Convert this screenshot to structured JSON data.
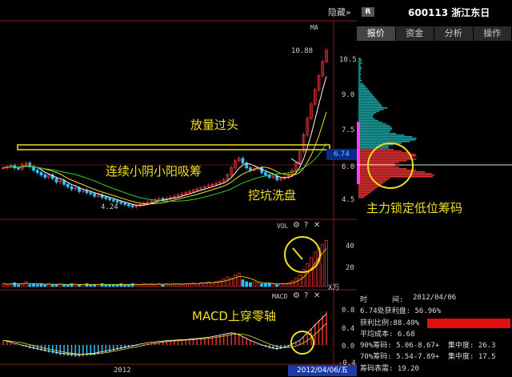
{
  "header": {
    "badge": "R",
    "code": "600113 浙江东日",
    "hide": "隐藏»"
  },
  "tabs": [
    {
      "label": "报价",
      "active": true
    },
    {
      "label": "资金",
      "active": false
    },
    {
      "label": "分析",
      "active": false
    },
    {
      "label": "操作",
      "active": false
    }
  ],
  "chart": {
    "ma_label": "MA",
    "high_label": "10.88",
    "low_label": "4.24",
    "current_price": "6.74",
    "y_ticks": [
      "10.5",
      "9.0",
      "7.5",
      "6.0",
      "4.5"
    ],
    "vol_label": "VOL",
    "vol_ticks": [
      "40",
      "20"
    ],
    "vol_unit": "X万",
    "macd_label": "MACD",
    "macd_ticks": [
      "0.8",
      "0.4",
      "0.0",
      "-0.4"
    ],
    "x_year": "2012",
    "date_tag": "2012/04/06/五"
  },
  "annotations": {
    "volume_overshoot": "放量过头",
    "small_candles": "连续小阴小阳吸筹",
    "pit_wash": "挖坑洗盘",
    "lock_chips": "主力锁定低位筹码",
    "macd_cross": "MACD上穿零轴"
  },
  "info": {
    "time_label": "时",
    "time_mid": "间:",
    "time_value": "2012/04/06",
    "profit_line": "6.74处获利盘: 56.96%",
    "profit_ratio": "获利比例:88.40%",
    "avg_cost": "平均成本: 6.68",
    "chip90": "90%筹码: 5.06-8.67+",
    "conc90": "集中度: 26.3",
    "chip70": "70%筹码: 5.54-7.89+",
    "conc70": "集中度: 17.5",
    "chip_low": "筹码表需: 19.20"
  },
  "colors": {
    "up": "#e03030",
    "down": "#30c0ff",
    "annot": "#f0e020",
    "ma_white": "#ffffff",
    "ma_yellow": "#f0e020",
    "ma_green": "#30d030"
  },
  "chart_data": {
    "type": "candlestick",
    "x_year": "2012",
    "y_ticks": [
      10.5,
      9.0,
      7.5,
      6.0,
      4.5
    ],
    "high": 10.88,
    "low": 4.24,
    "current": 6.74,
    "closes": [
      5.9,
      5.95,
      6.0,
      5.9,
      5.85,
      6.05,
      6.1,
      5.95,
      5.8,
      5.7,
      5.6,
      5.5,
      5.6,
      5.45,
      5.3,
      5.35,
      5.2,
      5.1,
      5.0,
      5.05,
      4.9,
      4.95,
      4.85,
      4.8,
      4.7,
      4.75,
      4.65,
      4.6,
      4.55,
      4.5,
      4.45,
      4.4,
      4.35,
      4.3,
      4.25,
      4.3,
      4.35,
      4.4,
      4.45,
      4.5,
      4.55,
      4.6,
      4.55,
      4.6,
      4.65,
      4.7,
      4.75,
      4.8,
      4.85,
      4.9,
      4.95,
      5.0,
      5.05,
      5.1,
      5.15,
      5.2,
      5.25,
      5.3,
      5.4,
      5.6,
      5.9,
      6.2,
      6.3,
      6.1,
      5.9,
      5.8,
      5.85,
      5.9,
      5.7,
      5.6,
      5.5,
      5.55,
      5.4,
      5.45,
      5.5,
      5.6,
      5.8,
      6.1,
      6.6,
      7.3,
      8.0,
      8.6,
      9.2,
      9.8,
      10.4,
      10.88
    ],
    "volumes": [
      3,
      2,
      3,
      4,
      2,
      3,
      5,
      2,
      3,
      2,
      3,
      2,
      3,
      2,
      2,
      3,
      2,
      2,
      3,
      2,
      2,
      2,
      3,
      2,
      2,
      2,
      3,
      2,
      2,
      2,
      2,
      3,
      2,
      2,
      3,
      2,
      2,
      3,
      2,
      3,
      2,
      3,
      2,
      3,
      2,
      3,
      3,
      2,
      3,
      3,
      4,
      3,
      4,
      4,
      5,
      4,
      5,
      6,
      8,
      10,
      9,
      12,
      14,
      7,
      5,
      4,
      5,
      4,
      3,
      3,
      3,
      3,
      2,
      3,
      3,
      4,
      6,
      9,
      12,
      18,
      24,
      30,
      36,
      40,
      44,
      48
    ],
    "macd": [
      0.1,
      0.08,
      0.05,
      0.02,
      0,
      -0.03,
      -0.05,
      -0.08,
      -0.1,
      -0.12,
      -0.14,
      -0.16,
      -0.18,
      -0.2,
      -0.22,
      -0.24,
      -0.25,
      -0.26,
      -0.27,
      -0.28,
      -0.28,
      -0.27,
      -0.26,
      -0.25,
      -0.24,
      -0.22,
      -0.2,
      -0.18,
      -0.16,
      -0.14,
      -0.12,
      -0.1,
      -0.08,
      -0.06,
      -0.04,
      -0.02,
      0,
      0.02,
      0.04,
      0.05,
      0.06,
      0.07,
      0.08,
      0.09,
      0.1,
      0.1,
      0.11,
      0.12,
      0.12,
      0.13,
      0.14,
      0.15,
      0.16,
      0.17,
      0.18,
      0.2,
      0.22,
      0.24,
      0.26,
      0.28,
      0.3,
      0.28,
      0.25,
      0.2,
      0.15,
      0.1,
      0.06,
      0.02,
      -0.02,
      -0.05,
      -0.08,
      -0.1,
      -0.12,
      -0.1,
      -0.08,
      -0.05,
      0,
      0.05,
      0.1,
      0.2,
      0.3,
      0.4,
      0.5,
      0.6,
      0.7,
      0.8
    ]
  }
}
